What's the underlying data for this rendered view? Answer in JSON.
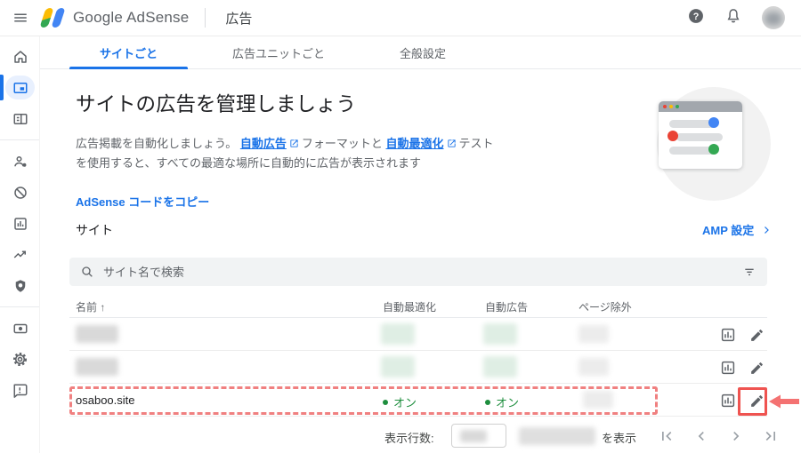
{
  "header": {
    "app_name": "Google AdSense",
    "page_title": "広告"
  },
  "tabs": [
    {
      "label": "サイトごと",
      "active": true
    },
    {
      "label": "広告ユニットごと",
      "active": false
    },
    {
      "label": "全般設定",
      "active": false
    }
  ],
  "hero": {
    "title": "サイトの広告を管理しましょう",
    "intro": "広告掲載を自動化しましょう。",
    "auto_ads_link": "自動広告",
    "middle_text": "フォーマットと",
    "auto_optimize_link": "自動最適化",
    "outro_text": "テストを使用すると、すべての最適な場所に自動的に広告が表示されます",
    "copy_code_link": "AdSense コードをコピー"
  },
  "sites": {
    "section_title": "サイト",
    "amp_settings_link": "AMP 設定",
    "search_placeholder": "サイト名で検索",
    "columns": {
      "name": "名前",
      "sort_indicator": "↑",
      "auto_optimize": "自動最適化",
      "auto_ads": "自動広告",
      "page_exclusions": "ページ除外"
    },
    "rows": [
      {
        "name": "",
        "auto_optimize": "",
        "auto_ads": "",
        "page_exclusions": "",
        "redacted": true
      },
      {
        "name": "",
        "auto_optimize": "",
        "auto_ads": "",
        "page_exclusions": "",
        "redacted": true
      },
      {
        "name": "osaboo.site",
        "auto_optimize": "オン",
        "auto_ads": "オン",
        "page_exclusions": "",
        "highlighted": true
      }
    ]
  },
  "footer": {
    "rows_per_page_label": "表示行数:",
    "display_suffix": "を表示"
  },
  "colors": {
    "accent_blue": "#1a73e8",
    "status_green": "#1e8e3e",
    "annotation_box_red": "#ef5350",
    "annotation_dash_red": "#f08080",
    "sidebar_active_bg": "#e8f0fe"
  }
}
